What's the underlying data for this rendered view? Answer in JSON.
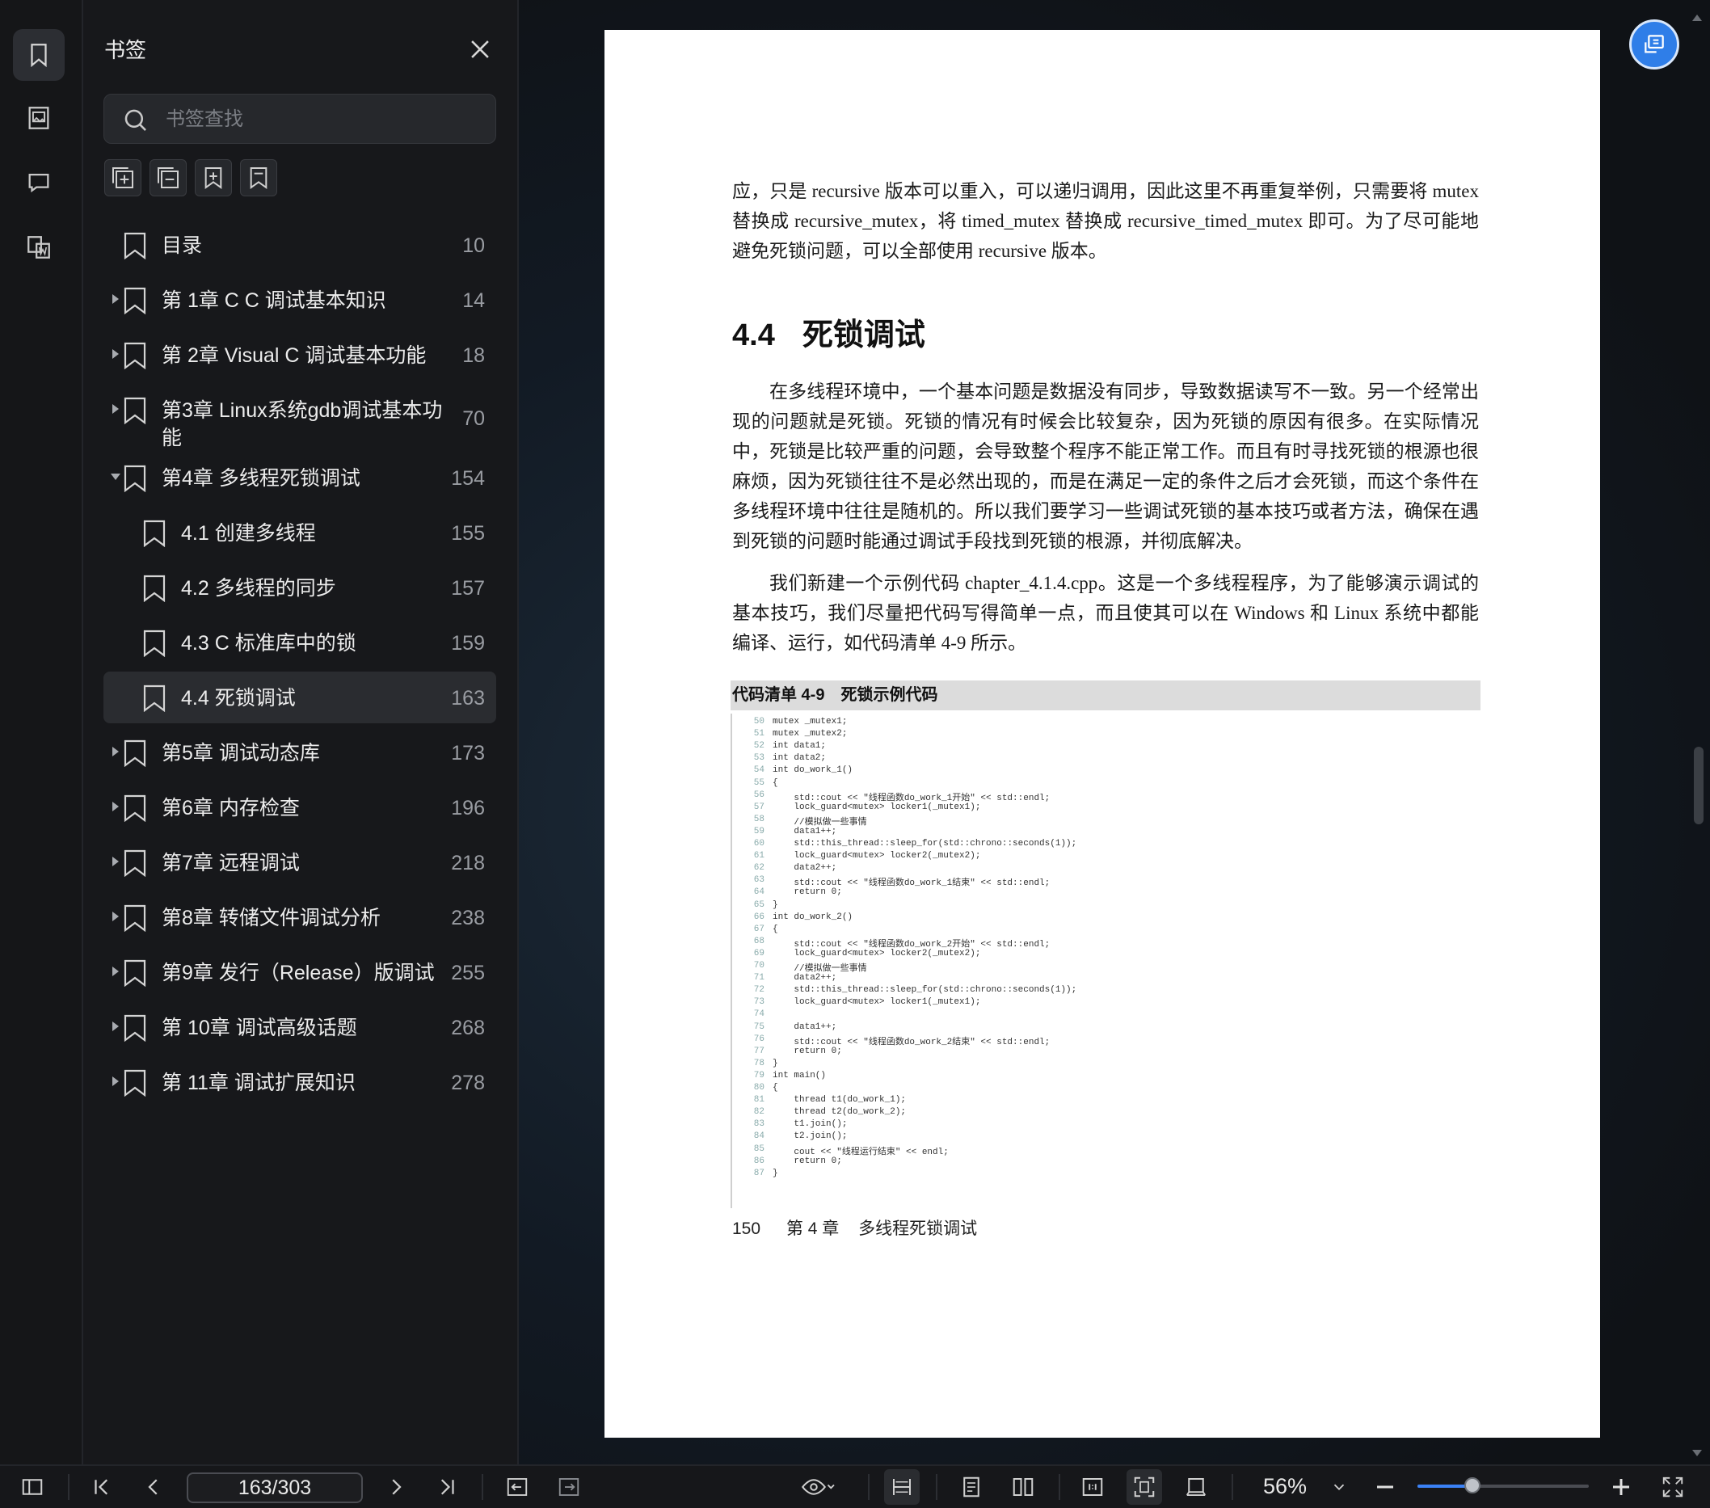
{
  "sidebar": {
    "title": "书签",
    "search_placeholder": "书签查找",
    "bookmarks": [
      {
        "label": "目录",
        "page": "10",
        "expandable": false,
        "indent": 0
      },
      {
        "label": "第 1章 C C 调试基本知识",
        "page": "14",
        "expandable": true,
        "indent": 0
      },
      {
        "label": "第 2章 Visual C 调试基本功能",
        "page": "18",
        "expandable": true,
        "indent": 0
      },
      {
        "label": "第3章 Linux系统gdb调试基本功",
        "label2": "能",
        "page": "70",
        "expandable": true,
        "indent": 0
      },
      {
        "label": "第4章 多线程死锁调试",
        "page": "154",
        "expandable": true,
        "expanded": true,
        "indent": 0
      },
      {
        "label": "4.1 创建多线程",
        "page": "155",
        "expandable": false,
        "indent": 1
      },
      {
        "label": "4.2 多线程的同步",
        "page": "157",
        "expandable": false,
        "indent": 1
      },
      {
        "label": "4.3 C 标准库中的锁",
        "page": "159",
        "expandable": false,
        "indent": 1
      },
      {
        "label": "4.4 死锁调试",
        "page": "163",
        "expandable": false,
        "indent": 1,
        "selected": true
      },
      {
        "label": "第5章 调试动态库",
        "page": "173",
        "expandable": true,
        "indent": 0
      },
      {
        "label": "第6章 内存检查",
        "page": "196",
        "expandable": true,
        "indent": 0
      },
      {
        "label": "第7章 远程调试",
        "page": "218",
        "expandable": true,
        "indent": 0
      },
      {
        "label": "第8章 转储文件调试分析",
        "page": "238",
        "expandable": true,
        "indent": 0
      },
      {
        "label": "第9章 发行（Release）版调试",
        "page": "255",
        "expandable": true,
        "indent": 0
      },
      {
        "label": "第 10章 调试高级话题",
        "page": "268",
        "expandable": true,
        "indent": 0
      },
      {
        "label": "第 11章 调试扩展知识",
        "page": "278",
        "expandable": true,
        "indent": 0
      }
    ]
  },
  "page": {
    "para1": "应，只是 recursive 版本可以重入，可以递归调用，因此这里不再重复举例，只需要将 mutex 替换成 recursive_mutex，将 timed_mutex 替换成 recursive_timed_mutex 即可。为了尽可能地避免死锁问题，可以全部使用 recursive 版本。",
    "heading_num": "4.4",
    "heading_text": "死锁调试",
    "para2": "在多线程环境中，一个基本问题是数据没有同步，导致数据读写不一致。另一个经常出现的问题就是死锁。死锁的情况有时候会比较复杂，因为死锁的原因有很多。在实际情况中，死锁是比较严重的问题，会导致整个程序不能正常工作。而且有时寻找死锁的根源也很麻烦，因为死锁往往不是必然出现的，而是在满足一定的条件之后才会死锁，而这个条件在多线程环境中往往是随机的。所以我们要学习一些调试死锁的基本技巧或者方法，确保在遇到死锁的问题时能通过调试手段找到死锁的根源，并彻底解决。",
    "para3": "我们新建一个示例代码 chapter_4.1.4.cpp。这是一个多线程程序，为了能够演示调试的基本技巧，我们尽量把代码写得简单一点，而且使其可以在 Windows 和 Linux 系统中都能编译、运行，如代码清单 4-9 所示。",
    "code_caption": "代码清单 4-9　死锁示例代码",
    "code_lines": [
      "mutex _mutex1;",
      "mutex _mutex2;",
      "int data1;",
      "int data2;",
      "int do_work_1()",
      "{",
      "    std::cout << \"线程函数do_work_1开始\" << std::endl;",
      "    lock_guard<mutex> locker1(_mutex1);",
      "    //模拟做一些事情",
      "    data1++;",
      "    std::this_thread::sleep_for(std::chrono::seconds(1));",
      "    lock_guard<mutex> locker2(_mutex2);",
      "    data2++;",
      "    std::cout << \"线程函数do_work_1结束\" << std::endl;",
      "    return 0;",
      "}",
      "int do_work_2()",
      "{",
      "    std::cout << \"线程函数do_work_2开始\" << std::endl;",
      "    lock_guard<mutex> locker2(_mutex2);",
      "    //模拟做一些事情",
      "    data2++;",
      "    std::this_thread::sleep_for(std::chrono::seconds(1));",
      "    lock_guard<mutex> locker1(_mutex1);",
      "",
      "    data1++;",
      "    std::cout << \"线程函数do_work_2结束\" << std::endl;",
      "    return 0;",
      "}",
      "int main()",
      "{",
      "    thread t1(do_work_1);",
      "    thread t2(do_work_2);",
      "    t1.join();",
      "    t2.join();",
      "    cout << \"线程运行结束\" << endl;",
      "    return 0;",
      "}"
    ],
    "code_start_line": 50,
    "footer_page": "150",
    "footer_chapter": "第 4 章",
    "footer_title": "多线程死锁调试"
  },
  "toolbar": {
    "page_indicator": "163/303",
    "zoom": "56%",
    "zoom_fraction": 0.32
  },
  "colors": {
    "accent": "#3b82f6",
    "float_button": "#2f7ee8"
  }
}
